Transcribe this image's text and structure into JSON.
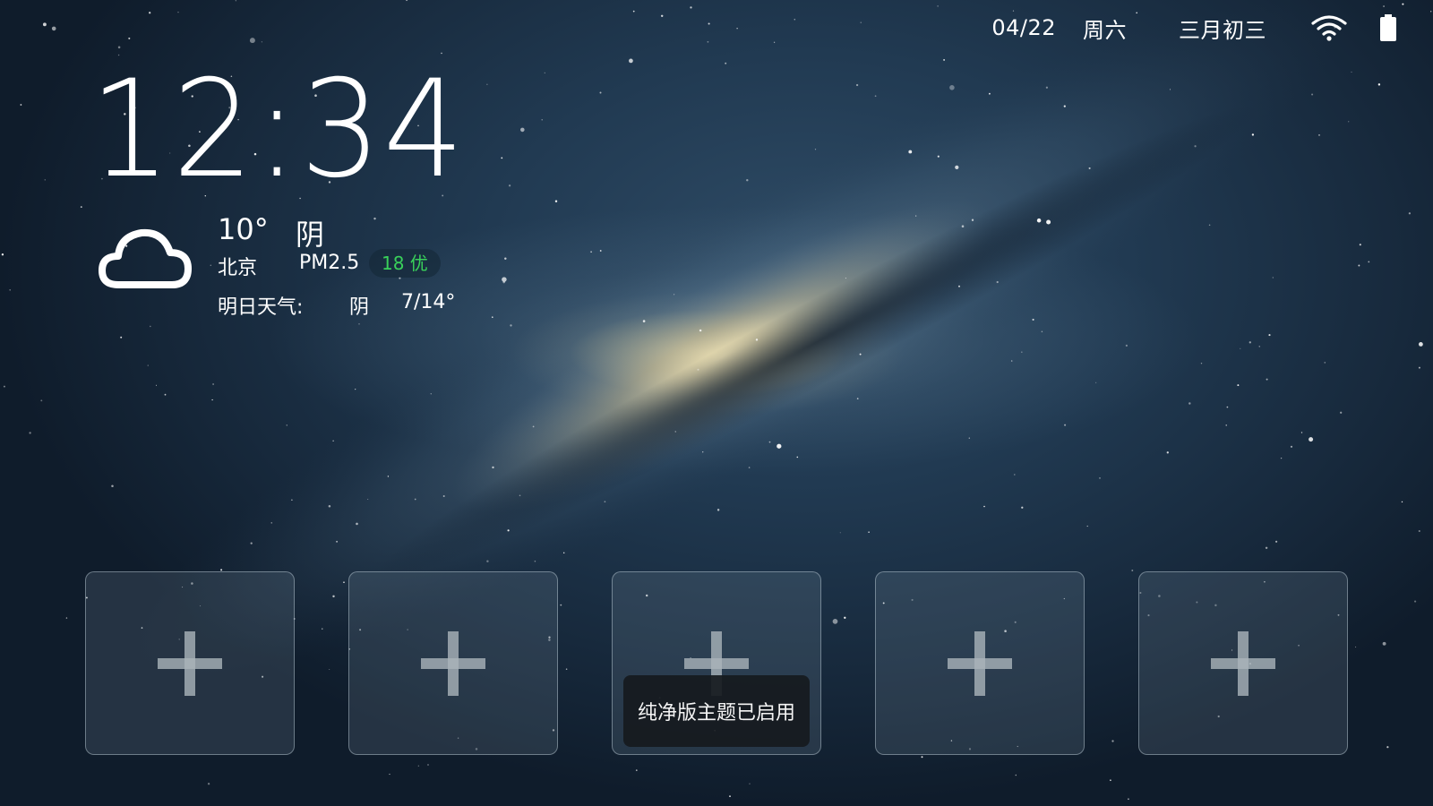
{
  "status_bar": {
    "date": "04/22",
    "weekday": "周六",
    "lunar_date": "三月初三",
    "wifi_icon": "wifi-icon",
    "battery_icon": "battery-icon"
  },
  "clock": {
    "time": "12:34"
  },
  "weather": {
    "icon": "cloud-icon",
    "temperature": "10°",
    "condition": "阴",
    "city": "北京",
    "pm_label": "PM2.5",
    "aqi": "18 优",
    "aqi_color": "#39d15a",
    "tomorrow_label": "明日天气:",
    "tomorrow_condition": "阴",
    "tomorrow_range": "7/14°"
  },
  "app_slots": [
    {
      "icon": "plus-icon"
    },
    {
      "icon": "plus-icon"
    },
    {
      "icon": "plus-icon"
    },
    {
      "icon": "plus-icon"
    },
    {
      "icon": "plus-icon"
    }
  ],
  "toast": {
    "message": "纯净版主题已启用"
  }
}
